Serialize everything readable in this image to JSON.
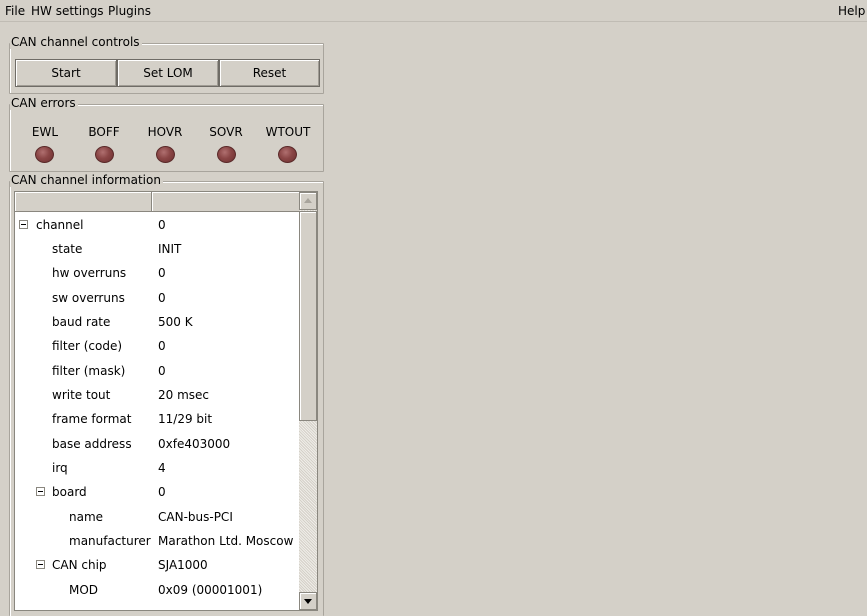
{
  "menubar": {
    "file": "File",
    "hw_settings": "HW settings",
    "plugins": "Plugins",
    "help": "Help"
  },
  "controls": {
    "title": "CAN channel controls",
    "start": "Start",
    "set_lom": "Set LOM",
    "reset": "Reset"
  },
  "errors": {
    "title": "CAN errors",
    "indicators": [
      {
        "label": "EWL",
        "state": "off",
        "color": "#8a4646"
      },
      {
        "label": "BOFF",
        "state": "off",
        "color": "#8a4646"
      },
      {
        "label": "HOVR",
        "state": "off",
        "color": "#8a4646"
      },
      {
        "label": "SOVR",
        "state": "off",
        "color": "#8a4646"
      },
      {
        "label": "WTOUT",
        "state": "off",
        "color": "#8a4646"
      }
    ]
  },
  "info": {
    "title": "CAN channel information",
    "header": [
      "",
      ""
    ],
    "rows": [
      {
        "name": "channel",
        "value": "0",
        "expanded": true
      },
      {
        "name": "state",
        "value": "INIT"
      },
      {
        "name": "hw overruns",
        "value": "0"
      },
      {
        "name": "sw overruns",
        "value": "0"
      },
      {
        "name": "baud rate",
        "value": "500 K"
      },
      {
        "name": "filter (code)",
        "value": "0"
      },
      {
        "name": "filter (mask)",
        "value": "0"
      },
      {
        "name": "write tout",
        "value": "20 msec"
      },
      {
        "name": "frame format",
        "value": "11/29 bit"
      },
      {
        "name": "base address",
        "value": "0xfe403000"
      },
      {
        "name": "irq",
        "value": "4"
      },
      {
        "name": "board",
        "value": "0",
        "expanded": true
      },
      {
        "name": "name",
        "value": "CAN-bus-PCI"
      },
      {
        "name": "manufacturer",
        "value": "Marathon Ltd. Moscow"
      },
      {
        "name": "CAN chip",
        "value": "SJA1000",
        "expanded": true
      },
      {
        "name": "MOD",
        "value": "0x09 (00001001)"
      }
    ]
  }
}
